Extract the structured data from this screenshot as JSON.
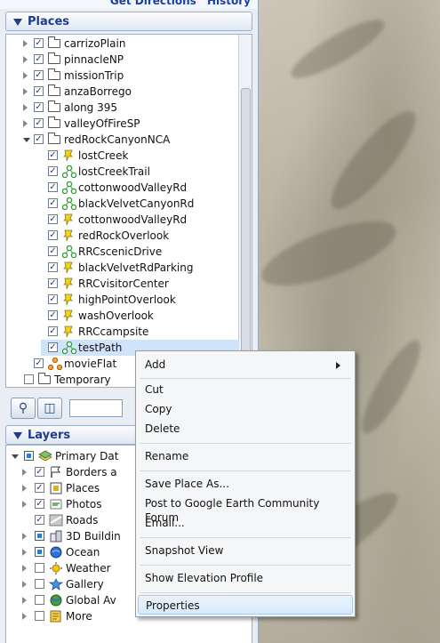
{
  "top_links": {
    "directions": "Get Directions",
    "history": "History"
  },
  "places_header": "Places",
  "places": [
    {
      "label": "carrizoPlain",
      "type": "folder",
      "level": 0,
      "checked": true,
      "expand": "closed"
    },
    {
      "label": "pinnacleNP",
      "type": "folder",
      "level": 0,
      "checked": true,
      "expand": "closed"
    },
    {
      "label": "missionTrip",
      "type": "folder",
      "level": 0,
      "checked": true,
      "expand": "closed"
    },
    {
      "label": "anzaBorrego",
      "type": "folder",
      "level": 0,
      "checked": true,
      "expand": "closed"
    },
    {
      "label": "along 395",
      "type": "folder",
      "level": 0,
      "checked": true,
      "expand": "closed"
    },
    {
      "label": "valleyOfFireSP",
      "type": "folder",
      "level": 0,
      "checked": true,
      "expand": "closed"
    },
    {
      "label": "redRockCanyonNCA",
      "type": "folder",
      "level": 0,
      "checked": true,
      "expand": "open"
    },
    {
      "label": "lostCreek",
      "type": "pin",
      "level": 1,
      "checked": true
    },
    {
      "label": "lostCreekTrail",
      "type": "path",
      "level": 1,
      "checked": true
    },
    {
      "label": "cottonwoodValleyRd",
      "type": "path",
      "level": 1,
      "checked": true
    },
    {
      "label": "blackVelvetCanyonRd",
      "type": "path",
      "level": 1,
      "checked": true
    },
    {
      "label": "cottonwoodValleyRd",
      "type": "pin",
      "level": 1,
      "checked": true
    },
    {
      "label": "redRockOverlook",
      "type": "pin",
      "level": 1,
      "checked": true
    },
    {
      "label": "RRCscenicDrive",
      "type": "path",
      "level": 1,
      "checked": true
    },
    {
      "label": "blackVelvetRdParking",
      "type": "pin",
      "level": 1,
      "checked": true
    },
    {
      "label": "RRCvisitorCenter",
      "type": "pin",
      "level": 1,
      "checked": true
    },
    {
      "label": "highPointOverlook",
      "type": "pin",
      "level": 1,
      "checked": true
    },
    {
      "label": "washOverlook",
      "type": "pin",
      "level": 1,
      "checked": true
    },
    {
      "label": "RRCcampsite",
      "type": "pin",
      "level": 1,
      "checked": true
    },
    {
      "label": "testPath",
      "type": "path",
      "level": 1,
      "checked": true,
      "selected": true
    },
    {
      "label": "movieFlat",
      "type": "orange",
      "level": 0,
      "checked": true
    },
    {
      "label": "Temporary",
      "type": "folder",
      "level": -1,
      "checked": false
    }
  ],
  "layers_header": "Layers",
  "layers": [
    {
      "label": "Primary Dat",
      "level": 0,
      "checked": "partial",
      "icon": "layers-icon",
      "expand": "open"
    },
    {
      "label": "Borders a",
      "level": 1,
      "checked": true,
      "icon": "flag-icon",
      "expand": "closed"
    },
    {
      "label": "Places",
      "level": 1,
      "checked": true,
      "icon": "places-icon",
      "expand": "closed"
    },
    {
      "label": "Photos",
      "level": 1,
      "checked": true,
      "icon": "photos-icon",
      "expand": "closed"
    },
    {
      "label": "Roads",
      "level": 1,
      "checked": true,
      "icon": "roads-icon",
      "expand": "none"
    },
    {
      "label": "3D Buildin",
      "level": 1,
      "checked": "partial",
      "icon": "buildings-icon",
      "expand": "closed"
    },
    {
      "label": "Ocean",
      "level": 1,
      "checked": "partial",
      "icon": "ocean-icon",
      "expand": "closed"
    },
    {
      "label": "Weather",
      "level": 1,
      "checked": false,
      "icon": "weather-icon",
      "expand": "closed"
    },
    {
      "label": "Gallery",
      "level": 1,
      "checked": false,
      "icon": "gallery-icon",
      "expand": "closed"
    },
    {
      "label": "Global Av",
      "level": 1,
      "checked": false,
      "icon": "globe-icon",
      "expand": "closed"
    },
    {
      "label": "More",
      "level": 1,
      "checked": false,
      "icon": "more-icon",
      "expand": "closed"
    }
  ],
  "context_menu": {
    "add": "Add",
    "cut": "Cut",
    "copy": "Copy",
    "delete": "Delete",
    "rename": "Rename",
    "save_place_as": "Save Place As...",
    "post_forum": "Post to Google Earth Community Forum",
    "email": "Email...",
    "snapshot": "Snapshot View",
    "elevation": "Show Elevation Profile",
    "properties": "Properties"
  },
  "colors": {
    "accent": "#1e3c8c",
    "selection": "#cfe4fb",
    "menu_highlight": "#d8e9fb"
  }
}
